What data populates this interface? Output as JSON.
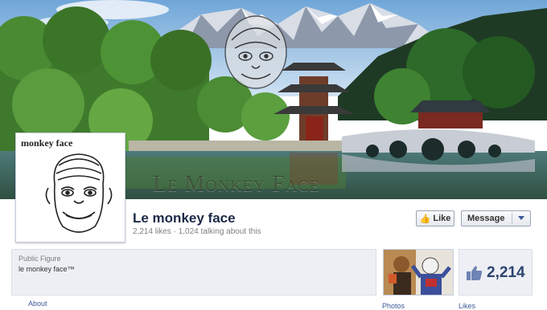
{
  "cover": {
    "watermark": "Le Monkey Face"
  },
  "profile": {
    "caption": "monkey face"
  },
  "page": {
    "name": "Le monkey face",
    "stats": "2,214 likes · 1,024 talking about this"
  },
  "actions": {
    "like_label": "Like",
    "message_label": "Message"
  },
  "info": {
    "category": "Public Figure",
    "description": "le monkey face™"
  },
  "likes_box": {
    "count": "2,214"
  },
  "links": {
    "about": "About",
    "photos": "Photos",
    "likes": "Likes"
  },
  "colors": {
    "brand_blue": "#3b5998",
    "panel_bg": "#edeff4",
    "name_text": "#1c2a47"
  }
}
